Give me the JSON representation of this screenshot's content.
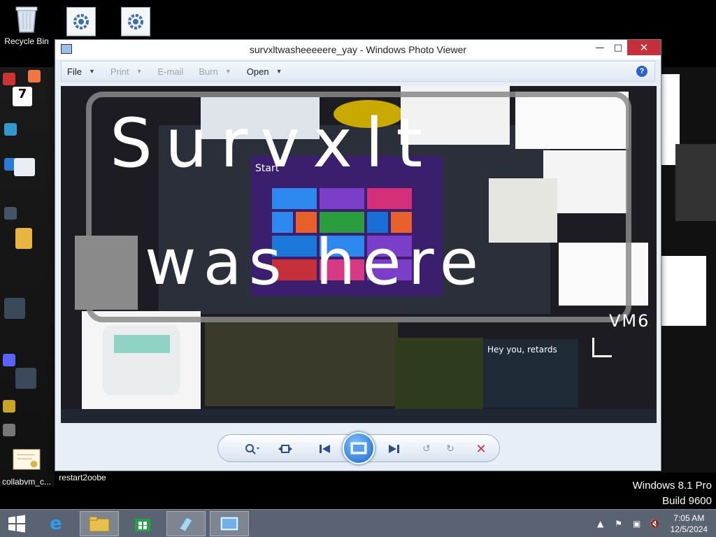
{
  "desktop": {
    "icons": {
      "recycle_bin": "Recycle Bin",
      "collabvm_cert": "collabvm_c...",
      "restart": "restart2oobe"
    },
    "watermark": {
      "os": "Windows 8.1 Pro",
      "build": "Build 9600"
    }
  },
  "window": {
    "title": "survxltwasheeeeere_yay - Windows Photo Viewer",
    "controls": {
      "minimize": "—",
      "maximize": "□",
      "close": "✕"
    },
    "menu": [
      {
        "label": "File",
        "enabled": true
      },
      {
        "label": "Print",
        "enabled": false
      },
      {
        "label": "E-mail",
        "enabled": false
      },
      {
        "label": "Burn",
        "enabled": false
      },
      {
        "label": "Open",
        "enabled": true
      }
    ],
    "help": "?",
    "photo": {
      "scrawl_line1": "Survxlt",
      "scrawl_line2": "was here",
      "vm_label": "VM6",
      "start_label": "Start",
      "meme_text": "Hey you, retards"
    }
  },
  "taskbar": {
    "time": "7:05 AM",
    "date": "12/5/2024"
  },
  "colors": {
    "close": "#c7303b",
    "taskbar": "#5a6372",
    "accent": "#2a62c9"
  }
}
